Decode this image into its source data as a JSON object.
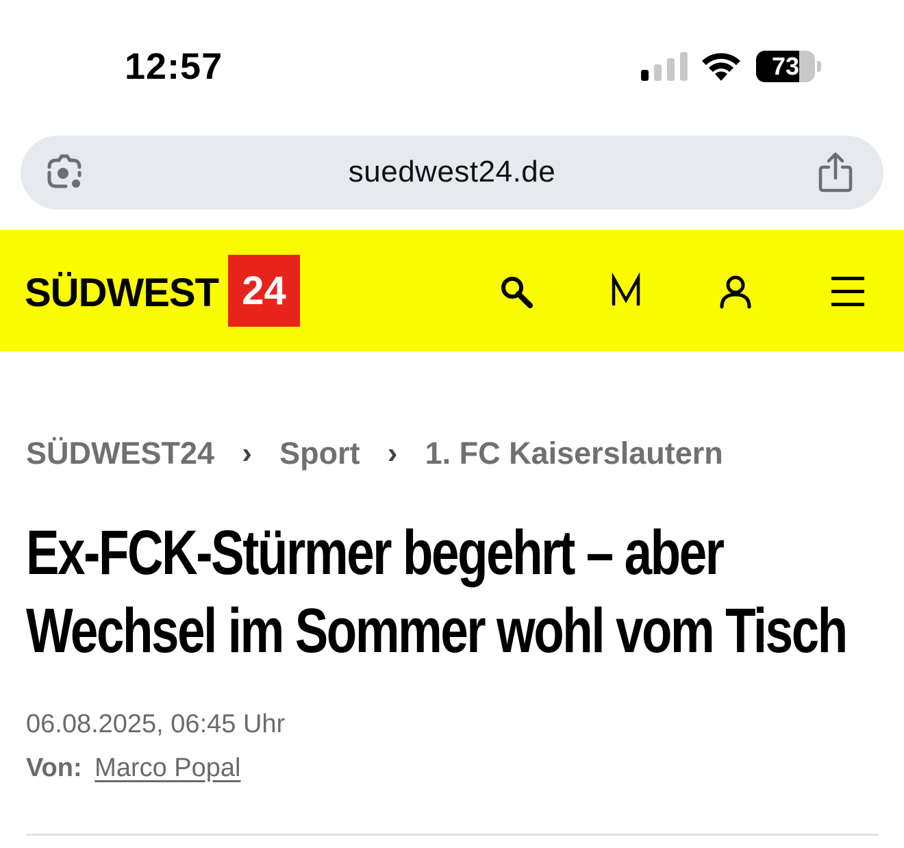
{
  "status_bar": {
    "time": "12:57",
    "battery_percent": "73",
    "battery_level": 0.73,
    "icons": [
      "cellular-signal-icon",
      "wifi-icon",
      "battery-icon"
    ]
  },
  "browser": {
    "url": "suedwest24.de",
    "icons": [
      "camera-search-icon",
      "share-icon"
    ]
  },
  "site_header": {
    "logo_word": "SÜDWEST",
    "logo_number": "24",
    "background_color": "#fcfc00",
    "logo_box_color": "#e8231b",
    "icons": [
      "search-icon",
      "merkliste-m-icon",
      "user-icon",
      "menu-icon"
    ]
  },
  "breadcrumb": {
    "items": [
      "SÜDWEST24",
      "Sport",
      "1. FC Kaiserslautern"
    ],
    "separator": "›"
  },
  "article": {
    "headline_line1": "Ex-FCK-Stürmer begehrt – aber",
    "headline_line2": "Wechsel im Sommer wohl vom Tisch",
    "date": "06.08.2025, 06:45 Uhr",
    "author_label": "Von:",
    "author_name": "Marco Popal"
  }
}
